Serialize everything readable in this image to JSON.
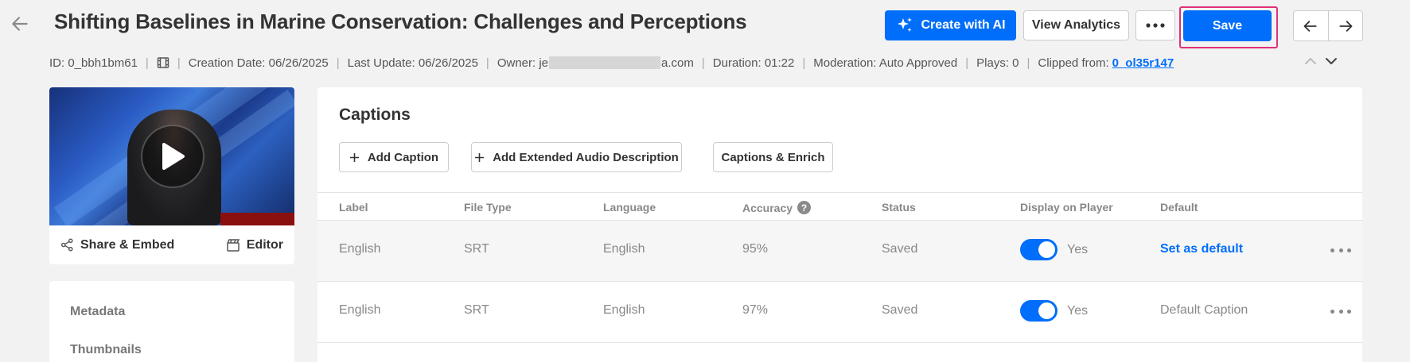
{
  "header": {
    "title": "Shifting Baselines in Marine Conservation: Challenges and Perceptions",
    "create_ai_label": "Create with AI",
    "view_analytics_label": "View Analytics",
    "save_label": "Save"
  },
  "meta": {
    "id": "ID: 0_bbh1bm61",
    "creation_date": "Creation Date: 06/26/2025",
    "last_update": "Last Update: 06/26/2025",
    "owner_prefix": "Owner: je",
    "owner_suffix": "a.com",
    "duration": "Duration: 01:22",
    "moderation": "Moderation: Auto Approved",
    "plays": "Plays: 0",
    "clipped_from_label": "Clipped from:",
    "clipped_from_value": "0_ol35r147"
  },
  "player_card": {
    "share_label": "Share & Embed",
    "editor_label": "Editor"
  },
  "side_menu": {
    "items": [
      "Metadata",
      "Thumbnails"
    ]
  },
  "captions": {
    "title": "Captions",
    "add_caption_label": "Add Caption",
    "add_audio_desc_label": "Add Extended Audio Description",
    "enrich_label": "Captions & Enrich",
    "columns": [
      "Label",
      "File Type",
      "Language",
      "Accuracy",
      "Status",
      "Display on Player",
      "Default"
    ],
    "rows": [
      {
        "label": "English",
        "file_type": "SRT",
        "language": "English",
        "accuracy": "95%",
        "status": "Saved",
        "display": "Yes",
        "default": "Set as default"
      },
      {
        "label": "English",
        "file_type": "SRT",
        "language": "English",
        "accuracy": "97%",
        "status": "Saved",
        "display": "Yes",
        "default": "Default Caption"
      }
    ]
  },
  "colors": {
    "primary": "#006efa",
    "highlight": "#e0307a"
  },
  "icons": [
    "back-arrow-icon",
    "sparkle-icon",
    "more-dots-icon",
    "arrow-left-icon",
    "arrow-right-icon",
    "film-icon",
    "chevron-up-icon",
    "chevron-down-icon",
    "play-icon",
    "share-icon",
    "editor-icon",
    "plus-icon",
    "help-icon"
  ]
}
